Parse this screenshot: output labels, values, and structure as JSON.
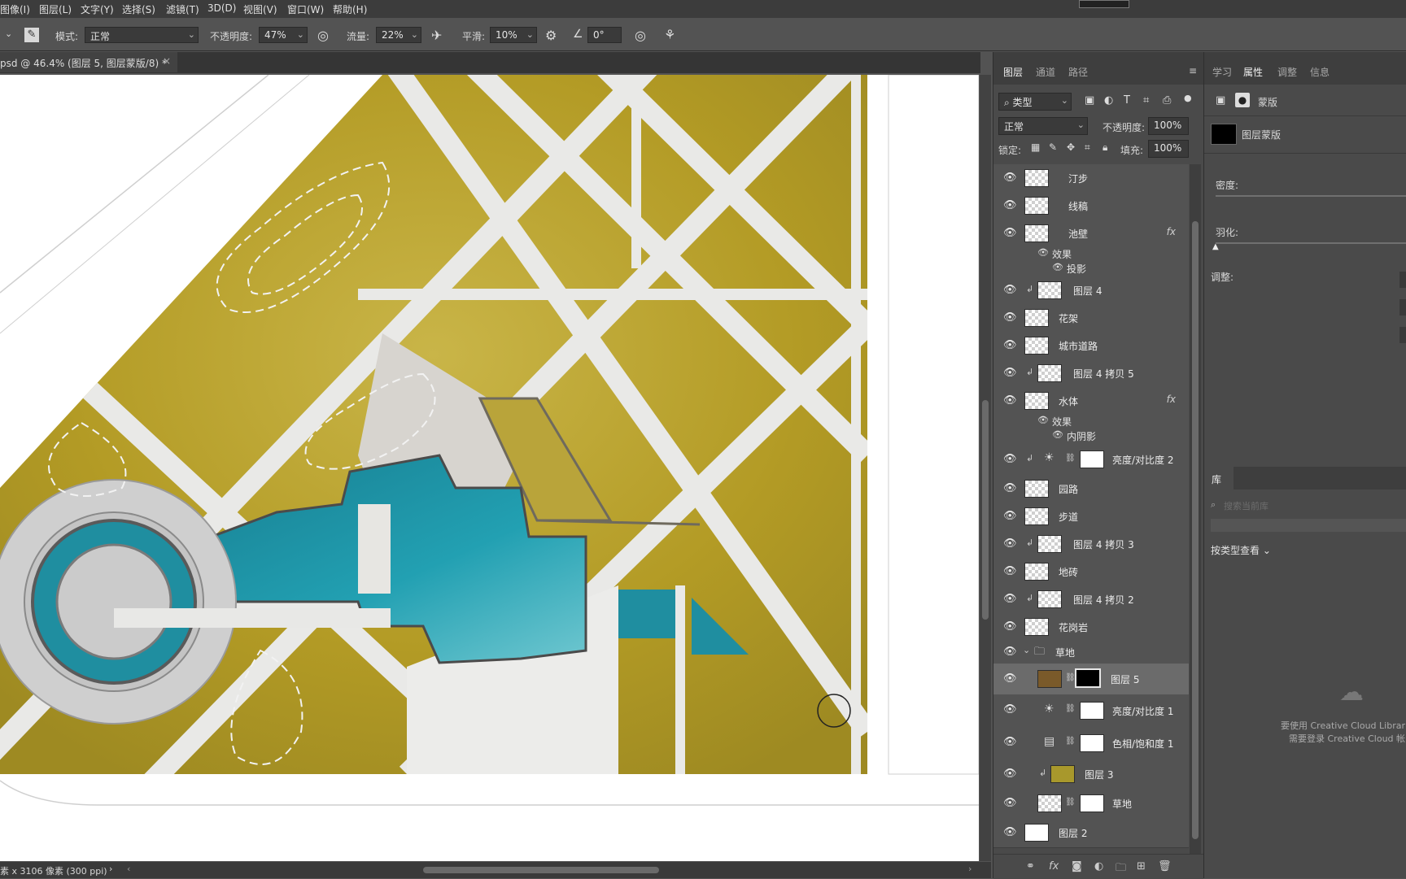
{
  "menu": [
    "图像(I)",
    "图层(L)",
    "文字(Y)",
    "选择(S)",
    "滤镜(T)",
    "3D(D)",
    "视图(V)",
    "窗口(W)",
    "帮助(H)"
  ],
  "options": {
    "mode_label": "模式:",
    "mode_value": "正常",
    "opacity_label": "不透明度:",
    "opacity_value": "47%",
    "flow_label": "流量:",
    "flow_value": "22%",
    "smooth_label": "平滑:",
    "smooth_value": "10%",
    "angle_value": "0°"
  },
  "doc_tab": {
    "title": "psd @ 46.4% (图层 5, 图层蒙版/8) *",
    "close": "×"
  },
  "status": {
    "text": "素 x 3106 像素 (300 ppi)",
    "arrow": "›",
    "left_arrow": "‹",
    "right_arrow": "›"
  },
  "layers_panel": {
    "tabs": [
      "图层",
      "通道",
      "路径"
    ],
    "filter_label": "类型",
    "blend_mode": "正常",
    "opacity_label": "不透明度:",
    "opacity_value": "100%",
    "lock_label": "锁定:",
    "fill_label": "填充:",
    "fill_value": "100%",
    "layers": [
      {
        "name": "汀步"
      },
      {
        "name": "线稿"
      },
      {
        "name": "池壁",
        "fx": "fx"
      },
      {
        "effects_label": "效果",
        "effect": "投影"
      },
      {
        "name": "图层 4"
      },
      {
        "name": "花架"
      },
      {
        "name": "城市道路"
      },
      {
        "name": "图层 4 拷贝 5"
      },
      {
        "name": "水体",
        "fx": "fx"
      },
      {
        "effects_label": "效果",
        "effect": "内阴影"
      },
      {
        "name": "亮度/对比度 2"
      },
      {
        "name": "园路"
      },
      {
        "name": "步道"
      },
      {
        "name": "图层 4 拷贝 3"
      },
      {
        "name": "地砖"
      },
      {
        "name": "图层 4 拷贝 2"
      },
      {
        "name": "花岗岩"
      },
      {
        "name": "草地"
      },
      {
        "name": "图层 5"
      },
      {
        "name": "亮度/对比度 1"
      },
      {
        "name": "色相/饱和度 1"
      },
      {
        "name": "图层 3"
      },
      {
        "name": "草地"
      },
      {
        "name": "图层 2"
      }
    ]
  },
  "properties_panel": {
    "tabs": [
      "学习",
      "属性",
      "调整",
      "信息"
    ],
    "mask_label": "蒙版",
    "layer_mask_label": "图层蒙版",
    "density_label": "密度:",
    "feather_label": "羽化:",
    "adjust_label": "调整:"
  },
  "library": {
    "title": "库",
    "search_placeholder": "搜索当前库",
    "view_by": "按类型查看",
    "message_line1": "要使用 Creative Cloud Librar",
    "message_line2": "需要登录 Creative Cloud 帐"
  },
  "colors": {
    "grass": "#b8a22a",
    "water": "#1f8ea0",
    "path": "#e8e8e6",
    "panel": "#535353"
  }
}
